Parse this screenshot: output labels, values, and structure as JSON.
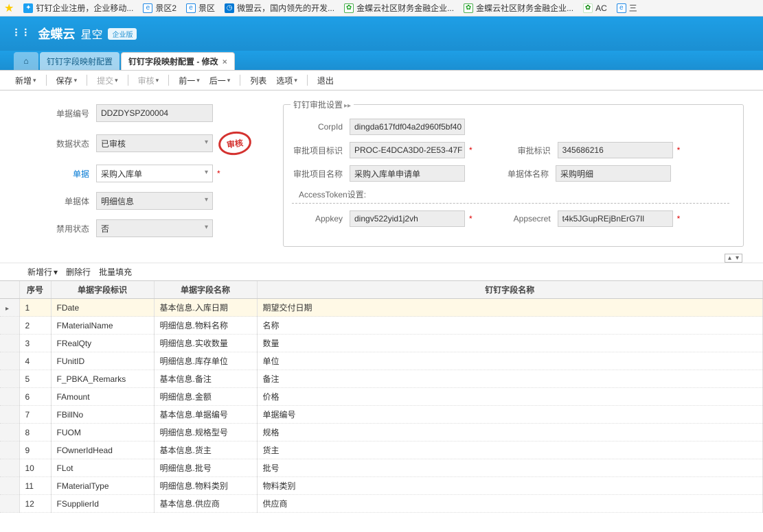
{
  "bookmarks": [
    {
      "icon": "blue",
      "text": "钉钉企业注册，企业移动..."
    },
    {
      "icon": "ie",
      "text": "景区2"
    },
    {
      "icon": "ie",
      "text": "景区"
    },
    {
      "icon": "orange",
      "text": "微盟云，国内领先的开发..."
    },
    {
      "icon": "kd",
      "text": "金蝶云社区财务金融企业..."
    },
    {
      "icon": "kd",
      "text": "金蝶云社区财务金融企业..."
    },
    {
      "icon": "ac",
      "text": "AC"
    },
    {
      "icon": "ie",
      "text": "三"
    }
  ],
  "brand": {
    "p1": "金蝶云",
    "p2": "星空",
    "badge": "企业版"
  },
  "tabs": {
    "home": "⌂",
    "inactive": "钉钉字段映射配置",
    "active": "钉钉字段映射配置 - 修改"
  },
  "toolbar": {
    "new": "新增",
    "save": "保存",
    "submit": "提交",
    "audit": "审核",
    "prev": "前一",
    "next": "后一",
    "list": "列表",
    "options": "选项",
    "exit": "退出"
  },
  "form_left": {
    "billno": {
      "label": "单据编号",
      "value": "DDZDYSPZ00004"
    },
    "status": {
      "label": "数据状态",
      "value": "已审核"
    },
    "bill": {
      "label": "单据",
      "value": "采购入库单"
    },
    "entity": {
      "label": "单据体",
      "value": "明细信息"
    },
    "disable": {
      "label": "禁用状态",
      "value": "否"
    },
    "stamp": "审核"
  },
  "fs": {
    "legend": "钉钉审批设置",
    "corpid": {
      "label": "CorpId",
      "value": "dingda617fdf04a2d960f5bf40"
    },
    "proj_key": {
      "label": "审批项目标识",
      "value": "PROC-E4DCA3D0-2E53-47F"
    },
    "approve_key": {
      "label": "审批标识",
      "value": "345686216"
    },
    "proj_name": {
      "label": "审批项目名称",
      "value": "采购入库单申请单"
    },
    "entity_name": {
      "label": "单据体名称",
      "value": "采购明细"
    },
    "at_title": "AccessToken设置:",
    "appkey": {
      "label": "Appkey",
      "value": "dingv522yid1j2vh"
    },
    "appsecret": {
      "label": "Appsecret",
      "value": "t4k5JGupREjBnErG7Il"
    }
  },
  "grid_tb": {
    "add": "新增行",
    "del": "删除行",
    "fill": "批量填充"
  },
  "grid_head": {
    "no": "序号",
    "a": "单据字段标识",
    "b": "单据字段名称",
    "c": "钉钉字段名称"
  },
  "rows": [
    {
      "n": "1",
      "a": "FDate",
      "b": "基本信息.入库日期",
      "c": "期望交付日期"
    },
    {
      "n": "2",
      "a": "FMaterialName",
      "b": "明细信息.物料名称",
      "c": "名称"
    },
    {
      "n": "3",
      "a": "FRealQty",
      "b": "明细信息.实收数量",
      "c": "数量"
    },
    {
      "n": "4",
      "a": "FUnitID",
      "b": "明细信息.库存单位",
      "c": "单位"
    },
    {
      "n": "5",
      "a": "F_PBKA_Remarks",
      "b": "基本信息.备注",
      "c": "备注"
    },
    {
      "n": "6",
      "a": "FAmount",
      "b": "明细信息.金额",
      "c": "价格"
    },
    {
      "n": "7",
      "a": "FBillNo",
      "b": "基本信息.单据编号",
      "c": "单据编号"
    },
    {
      "n": "8",
      "a": "FUOM",
      "b": "明细信息.规格型号",
      "c": "规格"
    },
    {
      "n": "9",
      "a": "FOwnerIdHead",
      "b": "基本信息.货主",
      "c": "货主"
    },
    {
      "n": "10",
      "a": "FLot",
      "b": "明细信息.批号",
      "c": "批号"
    },
    {
      "n": "11",
      "a": "FMaterialType",
      "b": "明细信息.物料类别",
      "c": "物料类别"
    },
    {
      "n": "12",
      "a": "FSupplierId",
      "b": "基本信息.供应商",
      "c": "供应商"
    }
  ]
}
